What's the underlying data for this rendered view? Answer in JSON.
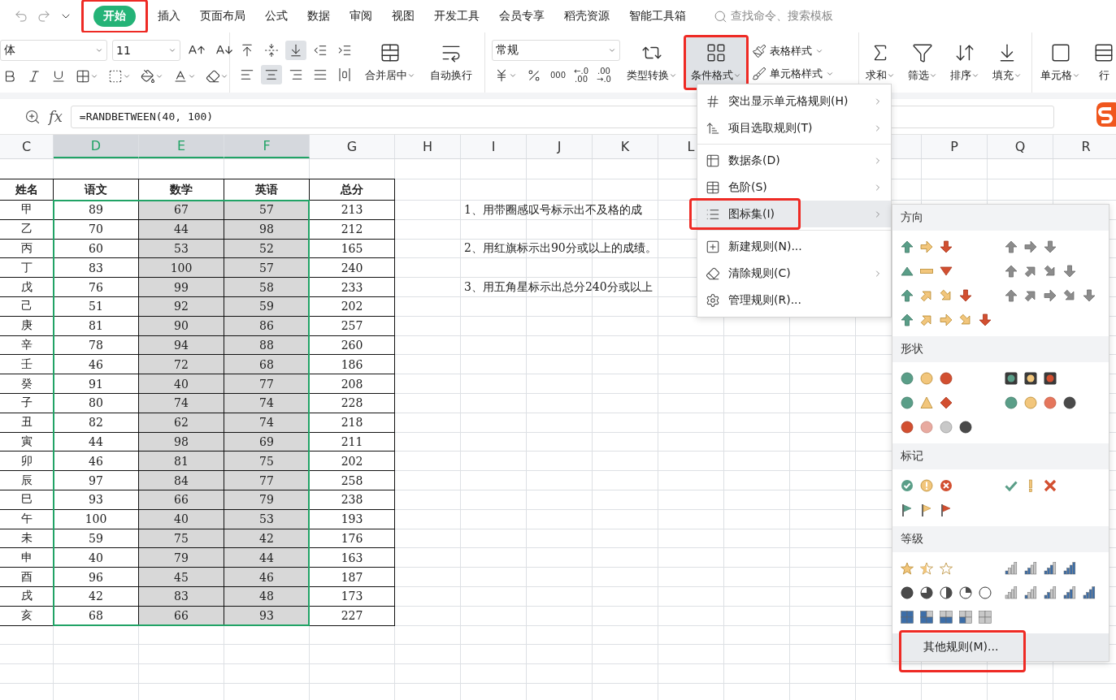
{
  "tabs": [
    {
      "label": "开始",
      "selected": true,
      "marked": true
    },
    {
      "label": "插入",
      "selected": false,
      "marked": false
    },
    {
      "label": "页面布局",
      "selected": false,
      "marked": false
    },
    {
      "label": "公式",
      "selected": false,
      "marked": false
    },
    {
      "label": "数据",
      "selected": false,
      "marked": false
    },
    {
      "label": "审阅",
      "selected": false,
      "marked": false
    },
    {
      "label": "视图",
      "selected": false,
      "marked": false
    },
    {
      "label": "开发工具",
      "selected": false,
      "marked": false
    },
    {
      "label": "会员专享",
      "selected": false,
      "marked": false
    },
    {
      "label": "稻壳资源",
      "selected": false,
      "marked": false
    },
    {
      "label": "智能工具箱",
      "selected": false,
      "marked": false
    }
  ],
  "search": {
    "placeholder": "查找命令、搜索模板"
  },
  "ribbon": {
    "font_name": "体",
    "font_size": "11",
    "align_buttons": [
      {
        "kind": "top",
        "selected": false
      },
      {
        "kind": "middle",
        "selected": false
      },
      {
        "kind": "bottom",
        "selected": true
      },
      {
        "kind": "indent-less",
        "selected": false
      },
      {
        "kind": "indent-more",
        "selected": false
      },
      {
        "kind": "left",
        "selected": false
      },
      {
        "kind": "center",
        "selected": true
      },
      {
        "kind": "right",
        "selected": false
      },
      {
        "kind": "justify",
        "selected": false
      },
      {
        "kind": "distributed",
        "selected": false
      }
    ],
    "merge_buttons": [
      {
        "label": "合并居中",
        "dropdown": true
      },
      {
        "label": "自动换行",
        "dropdown": false
      }
    ],
    "number_format": "常规",
    "number_buttons": [
      "000",
      "←.0\n.00",
      ".00\n→.0"
    ],
    "convert_button": {
      "label": "类型转换",
      "dropdown": true
    },
    "conditional_button": {
      "label": "条件格式",
      "dropdown": true,
      "selected": true,
      "marked": true
    },
    "style_buttons": [
      {
        "label": "表格样式",
        "dropdown": true
      },
      {
        "label": "单元格样式",
        "dropdown": true
      }
    ],
    "edit_buttons": [
      {
        "label": "求和",
        "dropdown": true
      },
      {
        "label": "筛选",
        "dropdown": true
      },
      {
        "label": "排序",
        "dropdown": true
      },
      {
        "label": "填充",
        "dropdown": true
      }
    ],
    "cell_buttons": [
      {
        "label": "单元格",
        "dropdown": true
      },
      {
        "label": "行",
        "dropdown": false
      }
    ]
  },
  "formula_bar": {
    "fx": "fx",
    "value": "=RANDBETWEEN(40, 100)"
  },
  "column_headers": [
    {
      "label": "C",
      "selected": false
    },
    {
      "label": "D",
      "selected": true
    },
    {
      "label": "E",
      "selected": true
    },
    {
      "label": "F",
      "selected": true
    },
    {
      "label": "G",
      "selected": false
    },
    {
      "label": "H",
      "selected": false
    },
    {
      "label": "I",
      "selected": false
    },
    {
      "label": "J",
      "selected": false
    },
    {
      "label": "K",
      "selected": false
    },
    {
      "label": "L",
      "selected": false
    }
  ],
  "column_headers_right": [
    {
      "label": "P",
      "selected": false
    },
    {
      "label": "Q",
      "selected": false
    },
    {
      "label": "R",
      "selected": false
    }
  ],
  "table": {
    "columns": [
      {
        "label": "姓名",
        "shaded": false
      },
      {
        "label": "语文",
        "shaded": false
      },
      {
        "label": "数学",
        "shaded": true
      },
      {
        "label": "英语",
        "shaded": true
      },
      {
        "label": "总分",
        "shaded": false
      }
    ],
    "rows": [
      [
        "甲",
        "89",
        "67",
        "57",
        "213"
      ],
      [
        "乙",
        "70",
        "44",
        "98",
        "212"
      ],
      [
        "丙",
        "60",
        "53",
        "52",
        "165"
      ],
      [
        "丁",
        "83",
        "100",
        "57",
        "240"
      ],
      [
        "戊",
        "76",
        "99",
        "58",
        "233"
      ],
      [
        "己",
        "51",
        "92",
        "59",
        "202"
      ],
      [
        "庚",
        "81",
        "90",
        "86",
        "257"
      ],
      [
        "辛",
        "78",
        "94",
        "88",
        "260"
      ],
      [
        "壬",
        "46",
        "72",
        "68",
        "186"
      ],
      [
        "癸",
        "91",
        "40",
        "77",
        "208"
      ],
      [
        "子",
        "80",
        "74",
        "74",
        "228"
      ],
      [
        "丑",
        "82",
        "62",
        "74",
        "218"
      ],
      [
        "寅",
        "44",
        "98",
        "69",
        "211"
      ],
      [
        "卯",
        "46",
        "81",
        "75",
        "202"
      ],
      [
        "辰",
        "97",
        "84",
        "77",
        "258"
      ],
      [
        "巳",
        "93",
        "66",
        "79",
        "238"
      ],
      [
        "午",
        "100",
        "40",
        "53",
        "193"
      ],
      [
        "未",
        "59",
        "75",
        "42",
        "176"
      ],
      [
        "申",
        "40",
        "79",
        "44",
        "163"
      ],
      [
        "酉",
        "96",
        "45",
        "46",
        "187"
      ],
      [
        "戌",
        "42",
        "83",
        "48",
        "173"
      ],
      [
        "亥",
        "68",
        "66",
        "93",
        "227"
      ]
    ]
  },
  "notes": [
    "1、用带圈感叹号标示出不及格的成",
    "2、用红旗标示出90分或以上的成绩。",
    "3、用五角星标示出总分240分或以上"
  ],
  "menu": {
    "groups": [
      [
        {
          "label": "突出显示单元格规则(H)",
          "submenu": true,
          "highlighted": false,
          "marked": false
        },
        {
          "label": "项目选取规则(T)",
          "submenu": true,
          "highlighted": false,
          "marked": false
        }
      ],
      [
        {
          "label": "数据条(D)",
          "submenu": true,
          "highlighted": false,
          "marked": false
        },
        {
          "label": "色阶(S)",
          "submenu": true,
          "highlighted": false,
          "marked": false
        },
        {
          "label": "图标集(I)",
          "submenu": true,
          "highlighted": true,
          "marked": true
        }
      ],
      [
        {
          "label": "新建规则(N)...",
          "submenu": false,
          "highlighted": false,
          "marked": false
        },
        {
          "label": "清除规则(C)",
          "submenu": true,
          "highlighted": false,
          "marked": false
        },
        {
          "label": "管理规则(R)...",
          "submenu": false,
          "highlighted": false,
          "marked": false
        }
      ]
    ]
  },
  "icon_sets": {
    "sections": [
      {
        "title": "方向",
        "sets": [
          {
            "kind": "arrows3"
          },
          {
            "kind": "arrows3-gray"
          },
          {
            "kind": "triangles3"
          },
          {
            "kind": "arrows4-gray"
          },
          {
            "kind": "arrows4"
          },
          {
            "kind": "arrows5-gray"
          },
          {
            "kind": "arrows5"
          }
        ]
      },
      {
        "title": "形状",
        "sets": [
          {
            "kind": "circles3"
          },
          {
            "kind": "lights3"
          },
          {
            "kind": "signs3"
          },
          {
            "kind": "circles4"
          },
          {
            "kind": "circles4-red"
          }
        ]
      },
      {
        "title": "标记",
        "sets": [
          {
            "kind": "symbols3-circled"
          },
          {
            "kind": "symbols3"
          },
          {
            "kind": "flags3"
          }
        ]
      },
      {
        "title": "等级",
        "sets": [
          {
            "kind": "stars3"
          },
          {
            "kind": "bars4"
          },
          {
            "kind": "pies5"
          },
          {
            "kind": "bars5"
          },
          {
            "kind": "quads5"
          }
        ]
      }
    ],
    "footer": {
      "label": "其他规则(M)...",
      "marked": true
    }
  }
}
